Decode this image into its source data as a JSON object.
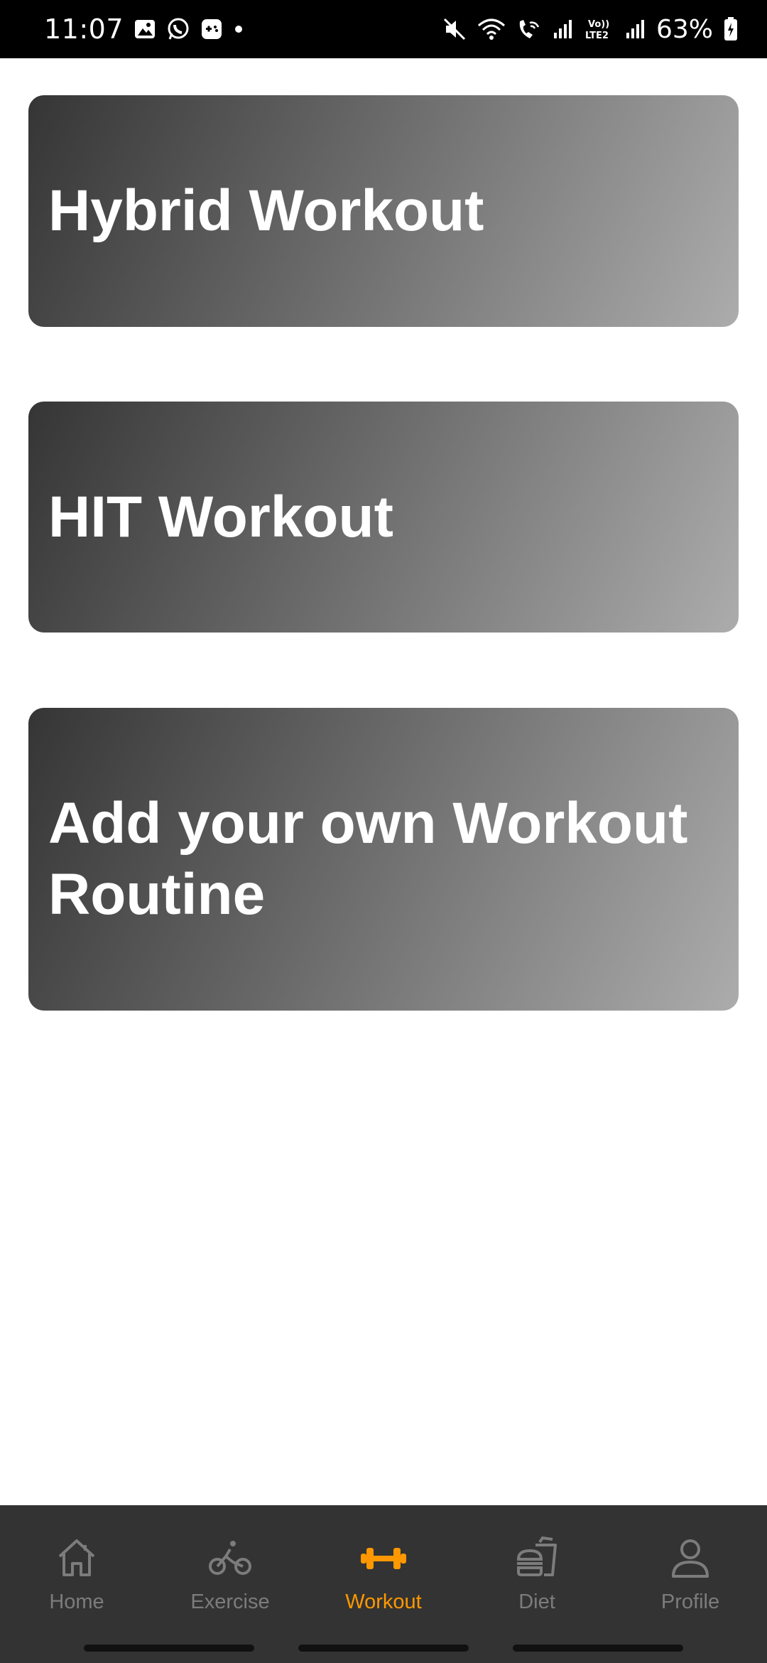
{
  "status_bar": {
    "time": "11:07",
    "battery": "63%",
    "left_icons": [
      "gallery-icon",
      "whatsapp-icon",
      "game-icon",
      "dot-icon"
    ],
    "right_icons": [
      "mute-icon",
      "wifi-icon",
      "wifi-calling-icon",
      "signal-icon",
      "volte-icon",
      "signal-2-icon",
      "battery-icon"
    ],
    "volte_text": "Vo)) LTE2"
  },
  "cards": [
    {
      "title": "Hybrid Workout"
    },
    {
      "title": "HIT Workout"
    },
    {
      "title": "Add your own Workout Routine"
    }
  ],
  "nav": {
    "active_color": "#ff9800",
    "inactive_color": "#7c7c7c",
    "items": [
      {
        "label": "Home",
        "icon": "home-icon"
      },
      {
        "label": "Exercise",
        "icon": "bicycle-icon"
      },
      {
        "label": "Workout",
        "icon": "dumbbell-icon",
        "active": true
      },
      {
        "label": "Diet",
        "icon": "food-icon"
      },
      {
        "label": "Profile",
        "icon": "person-icon"
      }
    ]
  }
}
